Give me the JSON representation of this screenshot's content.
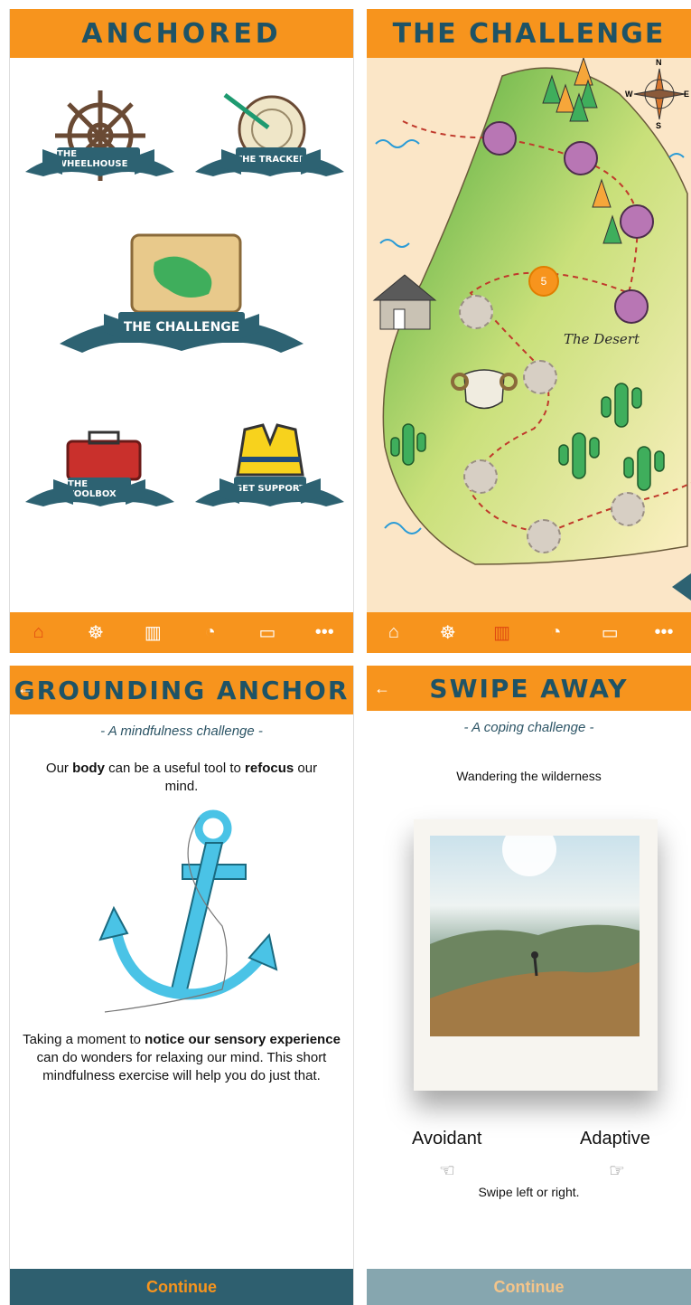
{
  "home": {
    "title": "ANCHORED",
    "tiles": {
      "wheelhouse": "THE WHEELHOUSE",
      "tracker": "THE TRACKER",
      "challenge": "THE CHALLENGE",
      "toolbox": "THE TOOLBOX",
      "support": "GET SUPPORT"
    }
  },
  "map": {
    "title": "THE CHALLENGE",
    "region_label": "The Desert",
    "current_node": "5",
    "compass": {
      "n": "N",
      "e": "E",
      "s": "S",
      "w": "W"
    }
  },
  "nav": {
    "items": [
      "home-icon",
      "wheel-icon",
      "map-icon",
      "gauge-icon",
      "toolbox-icon",
      "more-icon"
    ]
  },
  "grounding": {
    "back": "←",
    "title": "GROUNDING ANCHOR",
    "subtitle": "- A mindfulness challenge -",
    "intro_pre": "Our ",
    "intro_b1": "body",
    "intro_mid": " can be a useful tool to ",
    "intro_b2": "refocus",
    "intro_post": " our mind.",
    "desc_pre": "Taking a moment to ",
    "desc_b": "notice our sensory experience",
    "desc_post": " can do wonders for relaxing our mind. This short mindfulness exercise will help you do just that.",
    "continue": "Continue"
  },
  "swipe": {
    "back": "←",
    "title": "SWIPE AWAY",
    "subtitle": "- A coping challenge -",
    "prompt": "Wandering the wilderness",
    "left_option": "Avoidant",
    "right_option": "Adaptive",
    "instruction": "Swipe left or right.",
    "continue": "Continue"
  },
  "colors": {
    "orange": "#f7941d",
    "teal": "#2d6272",
    "purple_node": "#b876b4"
  }
}
